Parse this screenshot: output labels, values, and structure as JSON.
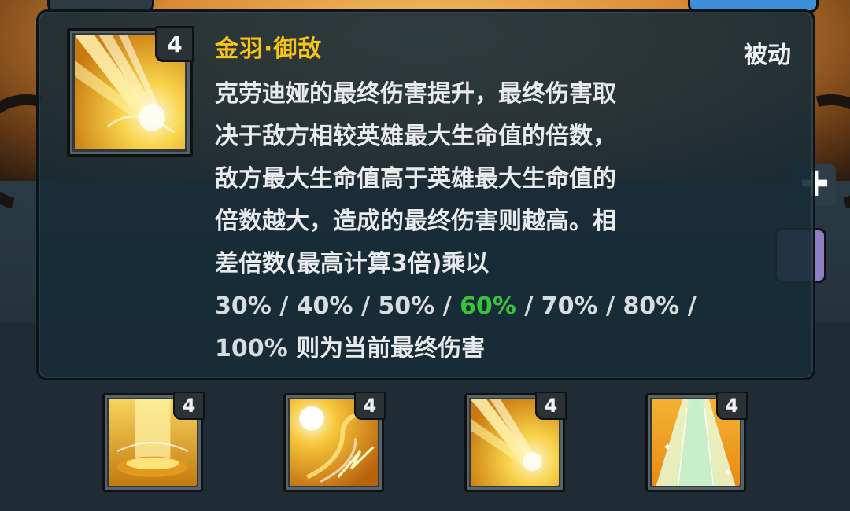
{
  "popup": {
    "skill_name": "金羽·御敌",
    "skill_type": "被动",
    "level": "4",
    "description_lines": [
      "克劳迪娅的最终伤害提升，最终伤害取",
      "决于敌方相较英雄最大生命值的倍数，",
      "敌方最大生命值高于英雄最大生命值的",
      "倍数越大，造成的最终伤害则越高。相",
      "差倍数(最高计算3倍)乘以"
    ],
    "percentages": [
      "30%",
      "40%",
      "50%",
      "60%",
      "70%",
      "80%",
      "100%"
    ],
    "active_percentage_index": 3,
    "separator": "/",
    "description_tail": "则为当前最终伤害",
    "colors": {
      "skill_name": "#f7c316",
      "active_percentage": "#3ac23d"
    }
  },
  "skill_slots": [
    {
      "level": "4",
      "icon": "golden-pillar-icon"
    },
    {
      "level": "4",
      "icon": "golden-sun-swirl-icon"
    },
    {
      "level": "4",
      "icon": "golden-feather-rays-icon"
    },
    {
      "level": "4",
      "icon": "golden-light-beam-icon"
    }
  ]
}
